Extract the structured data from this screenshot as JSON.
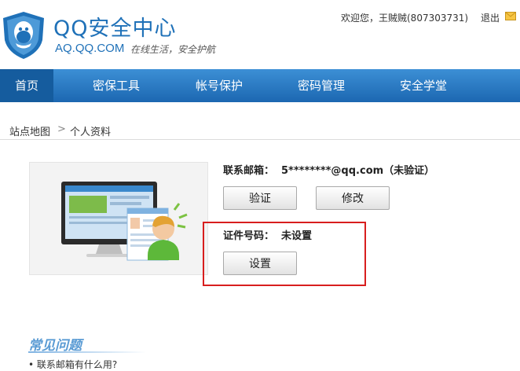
{
  "header": {
    "brand_name": "QQ安全中心",
    "brand_url": "AQ.QQ.COM",
    "slogan": "在线生活，安全护航",
    "welcome": "欢迎您，王贼贼(807303731)",
    "logout": "退出"
  },
  "nav": {
    "items": [
      {
        "label": "首页"
      },
      {
        "label": "密保工具"
      },
      {
        "label": "帐号保护"
      },
      {
        "label": "密码管理"
      },
      {
        "label": "安全学堂"
      }
    ]
  },
  "breadcrumb": {
    "home": "站点地图",
    "separator": ">",
    "current": "个人资料"
  },
  "profile": {
    "email_label": "联系邮箱：",
    "email_value": "5********@qq.com（未验证）",
    "verify_button": "验证",
    "modify_button": "修改",
    "id_label": "证件号码：",
    "id_value": "未设置",
    "set_button": "设置"
  },
  "faq": {
    "title": "常见问题",
    "items": [
      "联系邮箱有什么用?"
    ]
  },
  "colors": {
    "brand": "#1f71b8",
    "nav": "#2a7cc7",
    "highlight": "#d81e1e"
  }
}
